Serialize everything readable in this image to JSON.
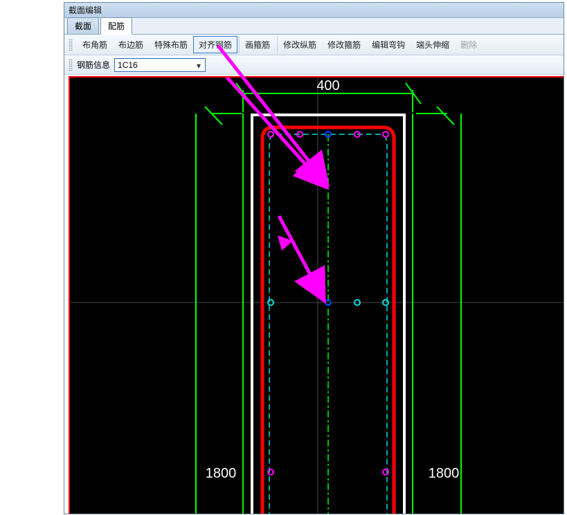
{
  "window": {
    "title": "截面编辑"
  },
  "tabs": {
    "items": [
      {
        "label": "截面",
        "active": false
      },
      {
        "label": "配筋",
        "active": true
      }
    ]
  },
  "toolbar": {
    "corner_rebar": "布角筋",
    "edge_rebar": "布边筋",
    "special_rebar": "特殊布筋",
    "align_rebar": "对齐钢筋",
    "draw_stirrup": "画箍筋",
    "modify_long": "修改纵筋",
    "modify_stirrup": "修改箍筋",
    "edit_hook": "编辑弯钩",
    "end_extend": "端头伸缩",
    "delete": "删除"
  },
  "infobar": {
    "label": "钢筋信息",
    "value": "1C16"
  },
  "dimensions": {
    "top": "400",
    "left": "1800",
    "right": "1800"
  }
}
